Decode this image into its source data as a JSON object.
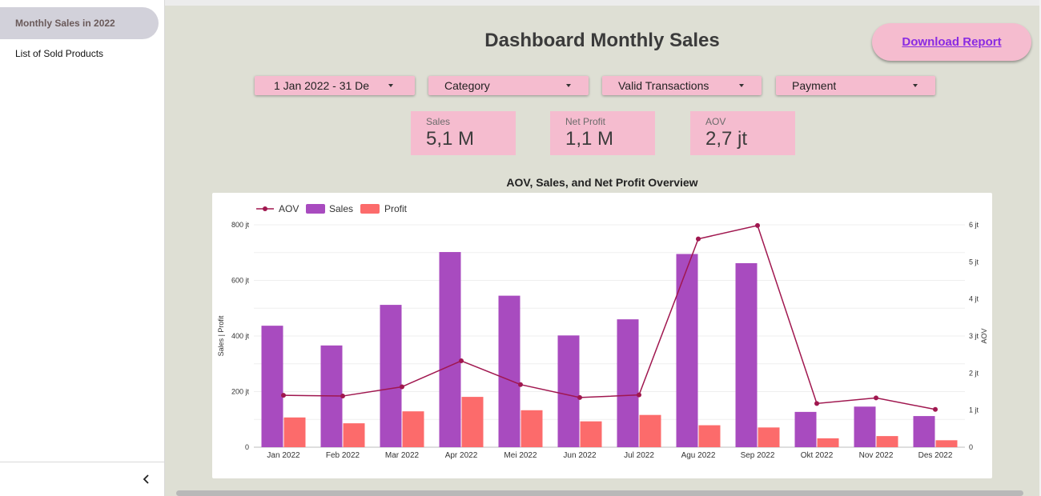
{
  "sidebar": {
    "items": [
      {
        "label": "Monthly Sales in 2022",
        "active": true
      },
      {
        "label": "List of Sold Products",
        "active": false
      }
    ],
    "collapse_icon": "chevron-left-icon"
  },
  "header": {
    "title": "Dashboard Monthly Sales",
    "download_label": "Download Report"
  },
  "filters": [
    {
      "label": "1 Jan 2022 - 31 De"
    },
    {
      "label": "Category"
    },
    {
      "label": "Valid Transactions"
    },
    {
      "label": "Payment"
    }
  ],
  "kpis": [
    {
      "label": "Sales",
      "value": "5,1 M"
    },
    {
      "label": "Net Profit",
      "value": "1,1 M"
    },
    {
      "label": "AOV",
      "value": "2,7 jt"
    }
  ],
  "colors": {
    "accent_pink": "#f5bccf",
    "canvas": "#dedfd4",
    "sales": "#a84bbf",
    "profit": "#fc6b6b",
    "aov": "#a0174f"
  },
  "chart_data": {
    "type": "bar",
    "title": "AOV, Sales, and Net Profit Overview",
    "categories": [
      "Jan 2022",
      "Feb 2022",
      "Mar 2022",
      "Apr 2022",
      "Mei 2022",
      "Jun 2022",
      "Jul 2022",
      "Agu 2022",
      "Sep 2022",
      "Okt 2022",
      "Nov 2022",
      "Des 2022"
    ],
    "series": [
      {
        "name": "Sales",
        "kind": "bar",
        "axis": "left",
        "values": [
          437,
          366,
          512,
          702,
          545,
          402,
          460,
          695,
          662,
          127,
          146,
          112
        ]
      },
      {
        "name": "Profit",
        "kind": "bar",
        "axis": "left",
        "values": [
          107,
          86,
          129,
          181,
          133,
          93,
          116,
          79,
          71,
          32,
          40,
          25
        ]
      },
      {
        "name": "AOV",
        "kind": "line",
        "axis": "right",
        "values": [
          1.4,
          1.38,
          1.63,
          2.33,
          1.69,
          1.34,
          1.41,
          5.62,
          5.98,
          1.18,
          1.33,
          1.02
        ]
      }
    ],
    "legend": [
      "AOV",
      "Sales",
      "Profit"
    ],
    "legend_position": "top-left",
    "ylabel": "Sales | Profit",
    "y2label": "AOV",
    "ylim": [
      0,
      800
    ],
    "y2lim": [
      0,
      6
    ],
    "yticks": [
      "0",
      "200 jt",
      "400 jt",
      "600 jt",
      "800 jt"
    ],
    "y2ticks": [
      "0",
      "1 jt",
      "2 jt",
      "3 jt",
      "4 jt",
      "5 jt",
      "6 jt"
    ],
    "grid": true
  }
}
